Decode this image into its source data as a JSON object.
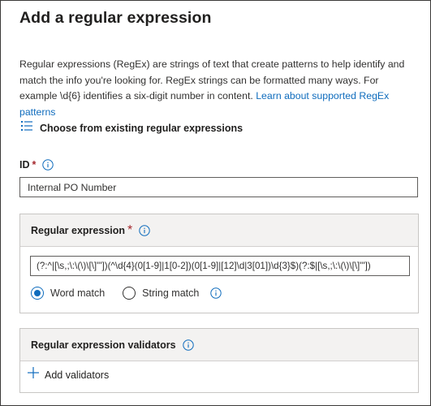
{
  "title": "Add a regular expression",
  "description": {
    "text": "Regular expressions (RegEx) are strings of text that create patterns to help identify and match the info you're looking for. RegEx strings can be formatted many ways. For example \\d{6} identifies a six-digit number in content. ",
    "link": "Learn about supported RegEx patterns"
  },
  "choose_existing": {
    "label": "Choose from existing regular expressions",
    "icon": "list-icon"
  },
  "id_field": {
    "label": "ID",
    "required": "*",
    "value": "Internal PO Number"
  },
  "regex_card": {
    "title": "Regular expression",
    "required": "*",
    "value": "(?:^|[\\s,;\\:\\(\\)\\[\\]\"'])(^\\d{4}(0[1-9]|1[0-2])(0[1-9]|[12]\\d|3[01])\\d{3}$)(?:$|[\\s,;\\:\\(\\)\\[\\]\"'])",
    "options": [
      {
        "label": "Word match",
        "selected": true
      },
      {
        "label": "String match",
        "selected": false
      }
    ]
  },
  "validators_card": {
    "title": "Regular expression validators",
    "add_label": "Add validators"
  },
  "colors": {
    "accent": "#0f6cbd",
    "required": "#a4262c",
    "header_bg": "#f3f2f1"
  }
}
